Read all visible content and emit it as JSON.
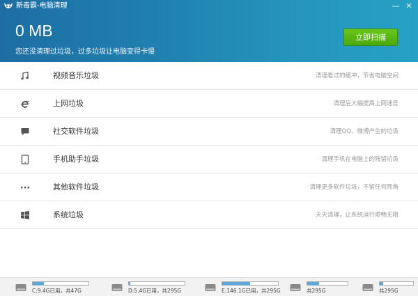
{
  "window": {
    "title": "新毒霸-电脑清理",
    "logo_icon": "leopard-logo-icon",
    "minimize_icon": "minimize-icon",
    "close_icon": "close-icon",
    "minimize_glyph": "—",
    "close_glyph": "✕"
  },
  "summary": {
    "size": "0 MB",
    "subtitle": "您还没清理过垃圾，过多垃圾让电脑变得卡慢",
    "scan_button": "立即扫描"
  },
  "colors": {
    "header_gradient": [
      "#1e6ea3",
      "#27a1c6"
    ],
    "scan_button": "#5ab515",
    "disk_fill": "#59a8e0"
  },
  "categories": [
    {
      "icon": "music-note-icon",
      "label": "视频音乐垃圾",
      "desc": "清理看过的缓冲，节省电脑空间"
    },
    {
      "icon": "browser-e-icon",
      "label": "上网垃圾",
      "desc": "清理后大幅提高上网速度"
    },
    {
      "icon": "chat-bubble-icon",
      "label": "社交软件垃圾",
      "desc": "清理QQ、微博产生的垃圾"
    },
    {
      "icon": "tablet-icon",
      "label": "手机助手垃圾",
      "desc": "清理手机在电脑上的残留垃圾"
    },
    {
      "icon": "more-dots-icon",
      "label": "其他软件垃圾",
      "desc": "清理更多软件垃圾，不留任何死角"
    },
    {
      "icon": "windows-logo-icon",
      "label": "系统垃圾",
      "desc": "天天清理，让系统运行顺畅无阻"
    }
  ],
  "disks": [
    {
      "icon": "hard-drive-icon",
      "text": "C:9.4G已用，共47G",
      "used_fraction": 0.2
    },
    {
      "icon": "hard-drive-icon",
      "text": "D:5.4G已用，共295G",
      "used_fraction": 0.02
    },
    {
      "icon": "hard-drive-icon",
      "text": "E:146.1G已用，共295G",
      "used_fraction": 0.5
    },
    {
      "icon": "hard-drive-icon",
      "text": "共295G",
      "used_fraction": 0.3
    },
    {
      "icon": "hard-drive-icon",
      "text": "共295G",
      "used_fraction": 0.1
    }
  ]
}
